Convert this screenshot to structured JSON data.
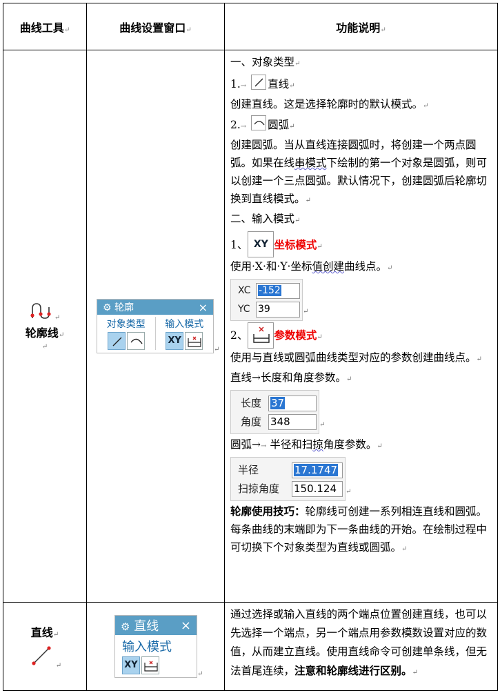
{
  "headers": {
    "tool": "曲线工具",
    "window": "曲线设置窗口",
    "desc": "功能说明"
  },
  "contour": {
    "tool_label": "轮廓线",
    "panel": {
      "title": "轮廓",
      "close": "×",
      "group1": "对象类型",
      "group2": "输入模式",
      "xy": "XY"
    },
    "desc": {
      "h1": "一、对象类型",
      "item1_num": "1.",
      "item1_name": "直线",
      "item1_text": "创建直线。这是选择轮廓时的默认模式。",
      "item2_num": "2.",
      "item2_name": "圆弧",
      "item2_text_a": "创建圆弧。当从直线连接圆弧时，将创建一个两点圆弧。如果在线",
      "item2_text_squig": "串模式",
      "item2_text_b": "下绘制的第一个对象是圆弧，则可以创建一个三点圆弧。默认情况下，创建圆弧后轮廓切换到直线模式。",
      "h2": "二、输入模式",
      "mode1_num": "1、",
      "mode1_btn": "XY",
      "mode1_name": "坐标模式",
      "mode1_text_a": "使用·X·和·Y·坐标",
      "mode1_text_squig": "值创建",
      "mode1_text_b": "曲线点。",
      "xc_label": "XC",
      "xc_value": "-152",
      "yc_label": "YC",
      "yc_value": "39",
      "mode2_num": "2、",
      "mode2_name": "参数模式",
      "mode2_text": "使用与直线或圆弧曲线类型对应的参数创建曲线点。",
      "line_param": "直线→长度和角度参数。",
      "len_label": "长度",
      "len_value": "37",
      "ang_label": "角度",
      "ang_value": "348",
      "arc_param_a": "圆弧→",
      "arc_param_b": "半径和扫",
      "arc_param_squig": "掠",
      "arc_param_c": "角度参数。",
      "rad_label": "半径",
      "rad_value": "17.1747",
      "sweep_label": "扫掠角度",
      "sweep_value": "150.124",
      "tip_bold": "轮廓使用技巧：",
      "tip_text": "轮廓线可创建一系列相连直线和圆弧。每条曲线的末端即为下一条曲线的开始。在绘制过程中可切换下个对象类型为直线或圆弧。"
    }
  },
  "line": {
    "tool_label": "直线",
    "panel": {
      "title": "直线",
      "close": "×",
      "group": "输入模式",
      "xy": "XY"
    },
    "desc_a": "通过选择或输入直线的两个端点位置创建直线，也可以先选择一个端点，另一个端点用参数模数设置对应的数值，从而建立直线。使用直线命令可创建单条线，但无法首尾连续，",
    "desc_bold": "注意和轮廓线进行区别。"
  },
  "colors": {
    "panel_header": "#5a9ec5",
    "group_title": "#1a6aa8",
    "red_text": "#e00000",
    "selected_value": "#2a76d2"
  },
  "marks": {
    "para": "↵",
    "arrow": "→"
  }
}
